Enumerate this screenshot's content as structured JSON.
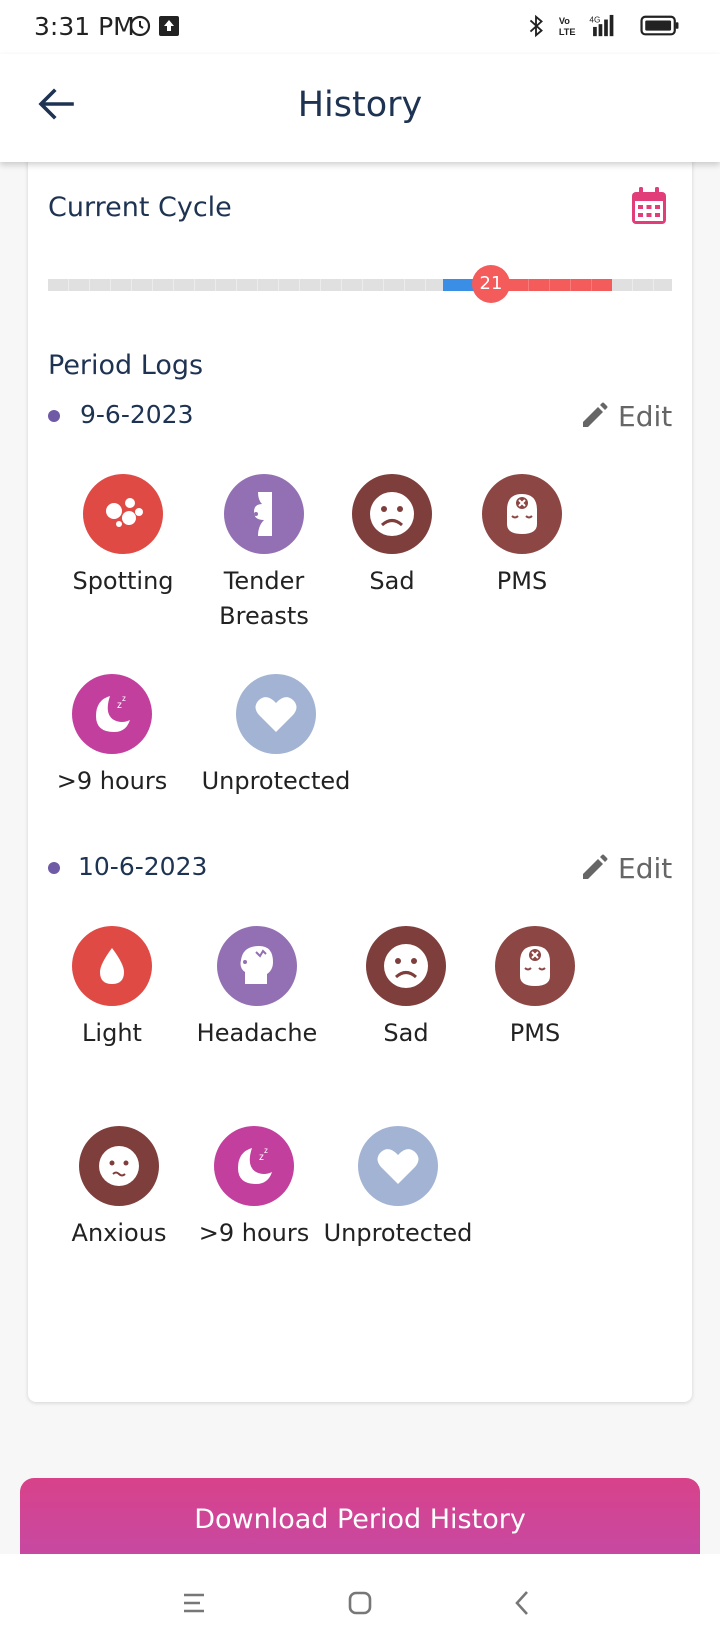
{
  "status_bar": {
    "time": "3:31 PM",
    "network": "4G"
  },
  "header": {
    "title": "History"
  },
  "current_cycle": {
    "title": "Current Cycle",
    "day_marker": "21"
  },
  "period_logs": {
    "title": "Period Logs",
    "edit_label": "Edit",
    "entries": [
      {
        "date": "9-6-2023",
        "symptoms": [
          {
            "label": "Spotting",
            "icon": "spotting-icon",
            "color": "#e04a45"
          },
          {
            "label": "Tender Breasts",
            "icon": "tender-breasts-icon",
            "color": "#9370b3"
          },
          {
            "label": "Sad",
            "icon": "sad-face-icon",
            "color": "#7e3e3b"
          },
          {
            "label": "PMS",
            "icon": "pms-icon",
            "color": "#8c4744"
          },
          {
            "label": ">9 hours",
            "icon": "sleep-moon-icon",
            "color": "#c23f9e"
          },
          {
            "label": "Unprotected",
            "icon": "heart-icon",
            "color": "#a2b3d3"
          }
        ]
      },
      {
        "date": "10-6-2023",
        "symptoms": [
          {
            "label": "Light",
            "icon": "drop-icon",
            "color": "#e04a45"
          },
          {
            "label": "Headache",
            "icon": "headache-icon",
            "color": "#9370b3"
          },
          {
            "label": "Sad",
            "icon": "sad-face-icon",
            "color": "#7e3e3b"
          },
          {
            "label": "PMS",
            "icon": "pms-icon",
            "color": "#8c4744"
          },
          {
            "label": "Anxious",
            "icon": "anxious-face-icon",
            "color": "#7e3e3b"
          },
          {
            "label": ">9 hours",
            "icon": "sleep-moon-icon",
            "color": "#c23f9e"
          },
          {
            "label": "Unprotected",
            "icon": "heart-icon",
            "color": "#a2b3d3"
          }
        ]
      }
    ]
  },
  "download_button": {
    "label": "Download Period History"
  },
  "colors": {
    "accent_blue": "#3b8ee6",
    "accent_red": "#f45b5b",
    "title": "#1e3352",
    "dot": "#6f5aa6"
  }
}
